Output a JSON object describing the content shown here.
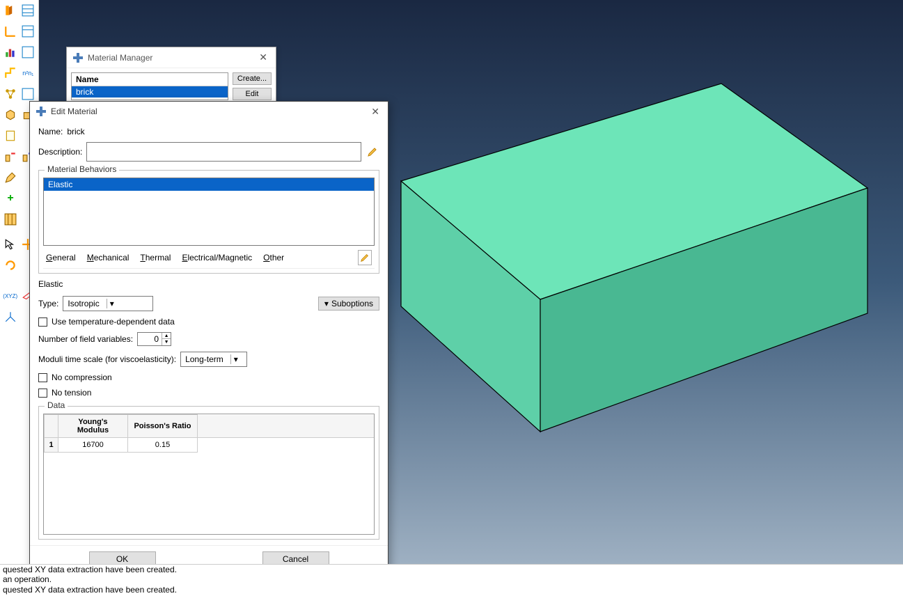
{
  "material_manager": {
    "title": "Material Manager",
    "name_header": "Name",
    "selected_material": "brick",
    "create_btn": "Create...",
    "edit_btn": "Edit"
  },
  "edit_material": {
    "title": "Edit Material",
    "name_label": "Name:",
    "name_value": "brick",
    "description_label": "Description:",
    "description_value": "",
    "behaviors_label": "Material Behaviors",
    "behaviors": [
      "Elastic"
    ],
    "tabs": {
      "general": "General",
      "mechanical": "Mechanical",
      "thermal": "Thermal",
      "electrical": "Electrical/Magnetic",
      "other": "Other"
    },
    "elastic": {
      "section": "Elastic",
      "type_label": "Type:",
      "type_value": "Isotropic",
      "suboptions": "Suboptions",
      "use_temp": "Use temperature-dependent data",
      "field_vars_label": "Number of field variables:",
      "field_vars_value": "0",
      "moduli_label": "Moduli time scale (for viscoelasticity):",
      "moduli_value": "Long-term",
      "no_compression": "No compression",
      "no_tension": "No tension",
      "data_label": "Data",
      "columns": [
        "Young's Modulus",
        "Poisson's Ratio"
      ],
      "rows": [
        {
          "idx": "1",
          "ym": "16700",
          "pr": "0.15"
        }
      ]
    },
    "ok": "OK",
    "cancel": "Cancel"
  },
  "console": {
    "line1": "quested XY data extraction have been created.",
    "line2": " an operation.",
    "line3": "quested XY data extraction have been created."
  }
}
